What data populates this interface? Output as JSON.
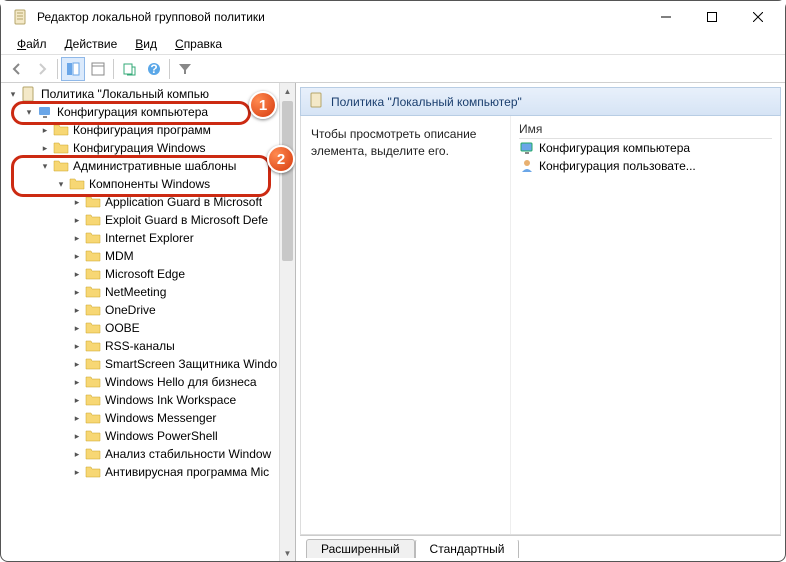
{
  "window": {
    "title": "Редактор локальной групповой политики"
  },
  "menu": {
    "file": "Файл",
    "action": "Действие",
    "view": "Вид",
    "help": "Справка"
  },
  "tree": {
    "root": "Политика \"Локальный компью",
    "computer_config": "Конфигурация компьютера",
    "software_settings": "Конфигурация программ",
    "windows_settings": "Конфигурация Windows",
    "admin_templates": "Административные шаблоны",
    "windows_components": "Компоненты Windows",
    "children": [
      "Application Guard в Microsoft",
      "Exploit Guard в Microsoft Defe",
      "Internet Explorer",
      "MDM",
      "Microsoft Edge",
      "NetMeeting",
      "OneDrive",
      "OOBE",
      "RSS-каналы",
      "SmartScreen Защитника Windo",
      "Windows Hello для бизнеса",
      "Windows Ink Workspace",
      "Windows Messenger",
      "Windows PowerShell",
      "Анализ стабильности Window",
      "Антивирусная программа Mic"
    ]
  },
  "detail": {
    "header": "Политика \"Локальный компьютер\"",
    "hint": "Чтобы просмотреть описание элемента, выделите его.",
    "col_name": "Имя",
    "item1": "Конфигурация компьютера",
    "item2": "Конфигурация пользовате..."
  },
  "tabs": {
    "extended": "Расширенный",
    "standard": "Стандартный"
  },
  "badges": {
    "b1": "1",
    "b2": "2"
  }
}
